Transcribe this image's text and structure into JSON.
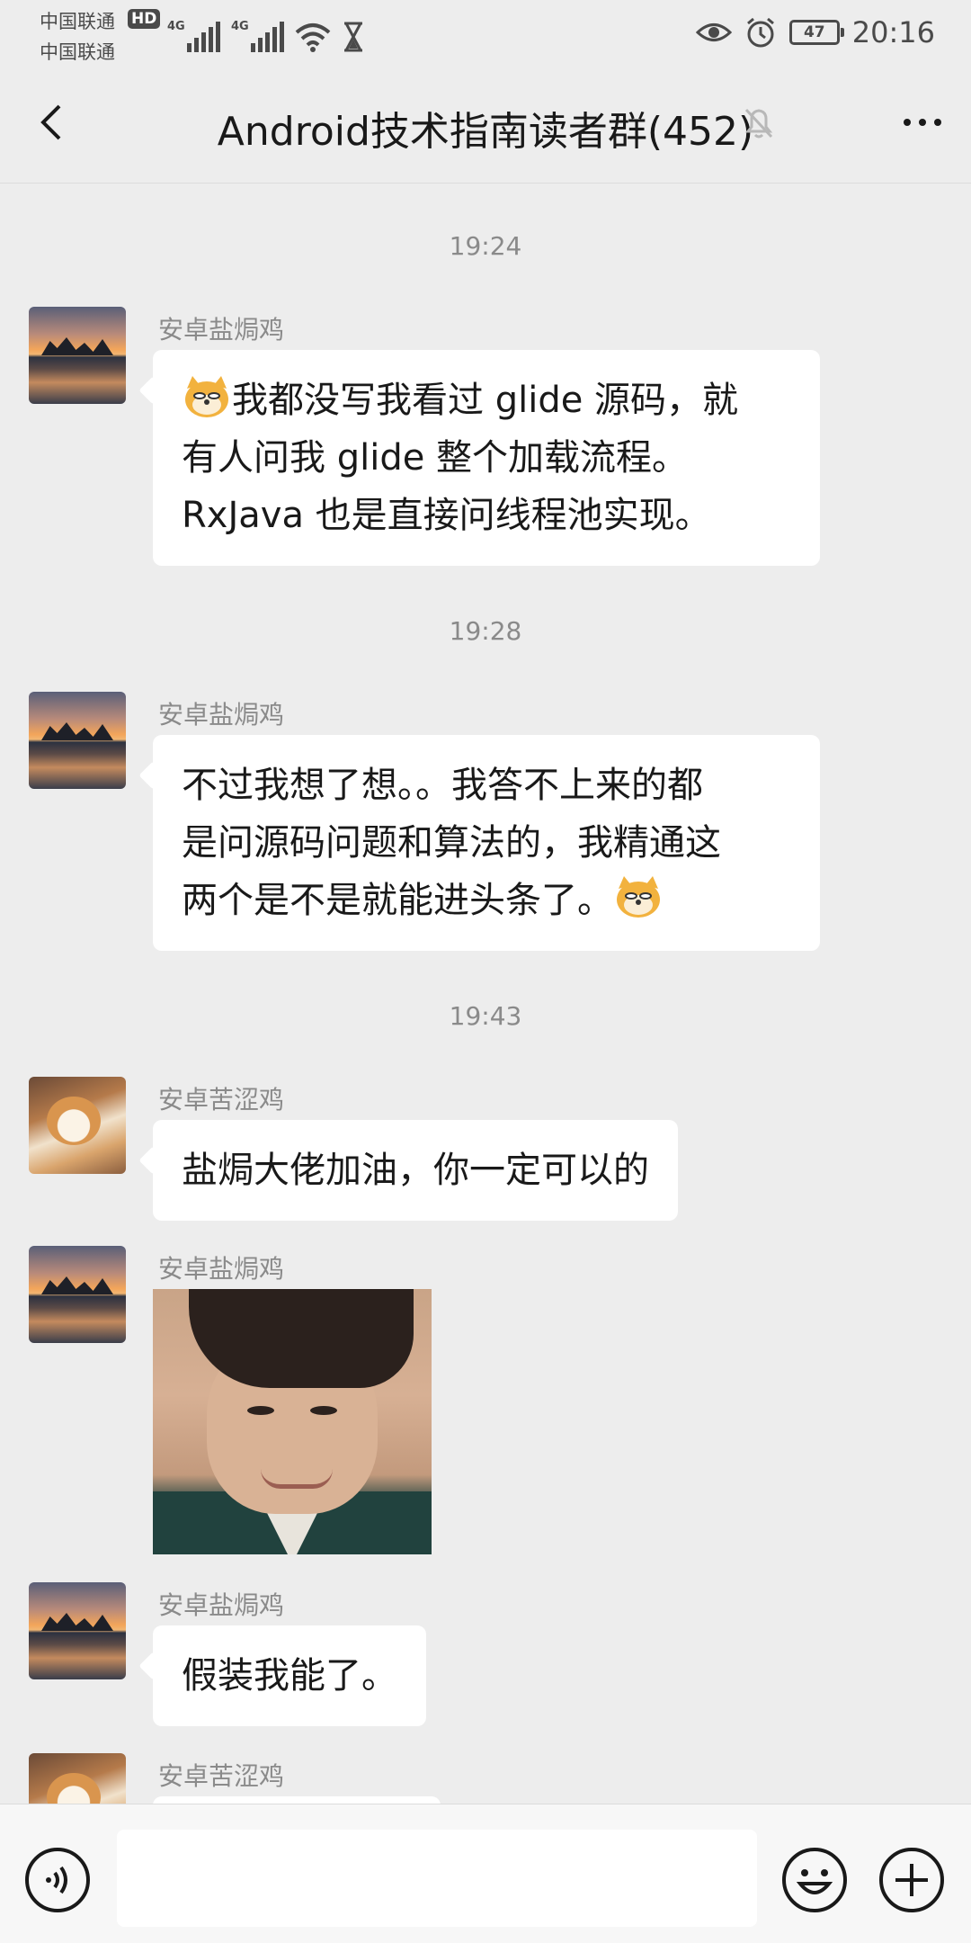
{
  "status_bar": {
    "carrier_1": "中国联通",
    "carrier_2": "中国联通",
    "hd_label": "HD",
    "network_1": "4G",
    "network_2": "4G",
    "battery": "47",
    "time": "20:16"
  },
  "header": {
    "title": "Android技术指南读者群(452)",
    "back_icon": "chevron-left-icon",
    "mute_icon": "bell-off-icon",
    "more_icon": "more-horizontal-icon"
  },
  "messages": [
    {
      "type": "time",
      "text": "19:24"
    },
    {
      "type": "text",
      "sender": "安卓盐焗鸡",
      "avatar": "sunset",
      "text_before": "",
      "emoji_before": "doge",
      "text": "我都没写我看过 glide 源码，就\n有人问我 glide 整个加载流程。\nRxJava 也是直接问线程池实现。"
    },
    {
      "type": "time",
      "text": "19:28"
    },
    {
      "type": "text",
      "sender": "安卓盐焗鸡",
      "avatar": "sunset",
      "text": "不过我想了想。。我答不上来的都\n是问源码问题和算法的，我精通这\n两个是不是就能进头条了。",
      "emoji_after": "doge"
    },
    {
      "type": "time",
      "text": "19:43"
    },
    {
      "type": "text",
      "sender": "安卓苦涩鸡",
      "avatar": "dog",
      "text": "盐焗大佬加油，你一定可以的"
    },
    {
      "type": "sticker",
      "sender": "安卓盐焗鸡",
      "avatar": "sunset"
    },
    {
      "type": "text",
      "sender": "安卓盐焗鸡",
      "avatar": "sunset",
      "text": "假装我能了。"
    },
    {
      "type": "partial",
      "sender": "安卓苦涩鸡",
      "avatar": "dog"
    }
  ],
  "input_bar": {
    "value": "",
    "voice_icon": "voice-icon",
    "emoji_icon": "smiley-icon",
    "plus_icon": "plus-circle-icon"
  },
  "colors": {
    "background": "#ededed",
    "bubble": "#ffffff",
    "meta_text": "#8a8a8a"
  }
}
